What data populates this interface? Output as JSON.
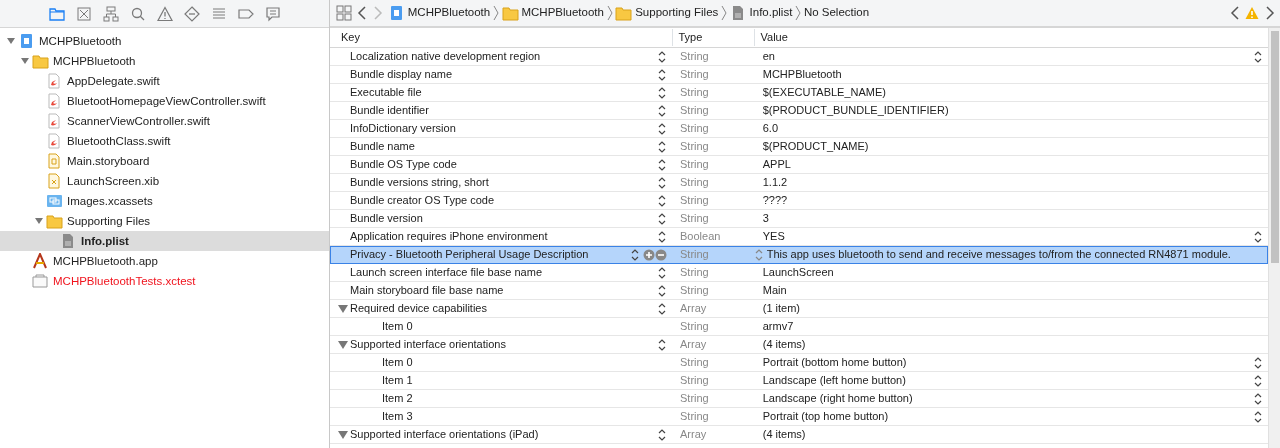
{
  "navigator_tabs": [
    {
      "kind": "folder",
      "selected": true
    },
    {
      "kind": "source",
      "selected": false
    },
    {
      "kind": "hierarchy",
      "selected": false
    },
    {
      "kind": "search",
      "selected": false
    },
    {
      "kind": "warning",
      "selected": false
    },
    {
      "kind": "test",
      "selected": false
    },
    {
      "kind": "debug",
      "selected": false
    },
    {
      "kind": "breakpoint",
      "selected": false
    },
    {
      "kind": "report",
      "selected": false
    }
  ],
  "navigator": [
    {
      "label": "MCHPBluetooth",
      "kind": "project",
      "expanded": true,
      "selected": false,
      "missing": false,
      "children": [
        {
          "label": "MCHPBluetooth",
          "kind": "folder",
          "expanded": true,
          "selected": false,
          "missing": false,
          "children": [
            {
              "label": "AppDelegate.swift",
              "kind": "swift",
              "selected": false,
              "missing": false
            },
            {
              "label": "BluetootHomepageViewController.swift",
              "kind": "swift",
              "selected": false,
              "missing": false
            },
            {
              "label": "ScannerViewController.swift",
              "kind": "swift",
              "selected": false,
              "missing": false
            },
            {
              "label": "BluetoothClass.swift",
              "kind": "swift",
              "selected": false,
              "missing": false
            },
            {
              "label": "Main.storyboard",
              "kind": "storyboard",
              "selected": false,
              "missing": false
            },
            {
              "label": "LaunchScreen.xib",
              "kind": "xib",
              "selected": false,
              "missing": false
            },
            {
              "label": "Images.xcassets",
              "kind": "assets",
              "selected": false,
              "missing": false
            },
            {
              "label": "Supporting Files",
              "kind": "folder",
              "expanded": true,
              "selected": false,
              "missing": false,
              "children": [
                {
                  "label": "Info.plist",
                  "kind": "plist",
                  "selected": true,
                  "missing": false
                }
              ]
            }
          ]
        },
        {
          "label": "MCHPBluetooth.app",
          "kind": "app",
          "selected": false,
          "missing": false
        },
        {
          "label": "MCHPBluetoothTests.xctest",
          "kind": "xctest",
          "selected": false,
          "missing": true
        }
      ]
    }
  ],
  "breadcrumb": [
    {
      "label": "MCHPBluetooth",
      "kind": "project"
    },
    {
      "label": "MCHPBluetooth",
      "kind": "folder"
    },
    {
      "label": "Supporting Files",
      "kind": "folder"
    },
    {
      "label": "Info.plist",
      "kind": "plist"
    },
    {
      "label": "No Selection",
      "kind": "none"
    }
  ],
  "table": {
    "columns": [
      "Key",
      "Type",
      "Value"
    ],
    "rows": [
      {
        "key": "Localization native development region",
        "type": "String",
        "value": "en",
        "value_menu": true,
        "selected": false
      },
      {
        "key": "Bundle display name",
        "type": "String",
        "value": "MCHPBluetooth",
        "value_menu": false,
        "selected": false
      },
      {
        "key": "Executable file",
        "type": "String",
        "value": "$(EXECUTABLE_NAME)",
        "value_menu": false,
        "selected": false
      },
      {
        "key": "Bundle identifier",
        "type": "String",
        "value": "$(PRODUCT_BUNDLE_IDENTIFIER)",
        "value_menu": false,
        "selected": false
      },
      {
        "key": "InfoDictionary version",
        "type": "String",
        "value": "6.0",
        "value_menu": false,
        "selected": false
      },
      {
        "key": "Bundle name",
        "type": "String",
        "value": "$(PRODUCT_NAME)",
        "value_menu": false,
        "selected": false
      },
      {
        "key": "Bundle OS Type code",
        "type": "String",
        "value": "APPL",
        "value_menu": false,
        "selected": false
      },
      {
        "key": "Bundle versions string, short",
        "type": "String",
        "value": "1.1.2",
        "value_menu": false,
        "selected": false
      },
      {
        "key": "Bundle creator OS Type code",
        "type": "String",
        "value": "????",
        "value_menu": false,
        "selected": false
      },
      {
        "key": "Bundle version",
        "type": "String",
        "value": "3",
        "value_menu": false,
        "selected": false
      },
      {
        "key": "Application requires iPhone environment",
        "type": "Boolean",
        "value": "YES",
        "value_menu": true,
        "selected": false
      },
      {
        "key": "Privacy - Bluetooth Peripheral Usage Description",
        "type": "String",
        "value": "This app uses bluetooth to send and receive messages to/from the connected RN4871 module.",
        "value_menu": false,
        "selected": true
      },
      {
        "key": "Launch screen interface file base name",
        "type": "String",
        "value": "LaunchScreen",
        "value_menu": false,
        "selected": false
      },
      {
        "key": "Main storyboard file base name",
        "type": "String",
        "value": "Main",
        "value_menu": false,
        "selected": false
      },
      {
        "key": "Required device capabilities",
        "type": "Array",
        "value": "(1 item)",
        "value_menu": false,
        "selected": false,
        "expanded": true,
        "children": [
          {
            "key": "Item 0",
            "type": "String",
            "value": "armv7",
            "value_menu": false,
            "selected": false
          }
        ]
      },
      {
        "key": "Supported interface orientations",
        "type": "Array",
        "value": "(4 items)",
        "value_menu": false,
        "selected": false,
        "expanded": true,
        "children": [
          {
            "key": "Item 0",
            "type": "String",
            "value": "Portrait (bottom home button)",
            "value_menu": true,
            "selected": false
          },
          {
            "key": "Item 1",
            "type": "String",
            "value": "Landscape (left home button)",
            "value_menu": true,
            "selected": false
          },
          {
            "key": "Item 2",
            "type": "String",
            "value": "Landscape (right home button)",
            "value_menu": true,
            "selected": false
          },
          {
            "key": "Item 3",
            "type": "String",
            "value": "Portrait (top home button)",
            "value_menu": true,
            "selected": false
          }
        ]
      },
      {
        "key": "Supported interface orientations (iPad)",
        "type": "Array",
        "value": "(4 items)",
        "value_menu": false,
        "selected": false,
        "expanded": true
      }
    ]
  }
}
